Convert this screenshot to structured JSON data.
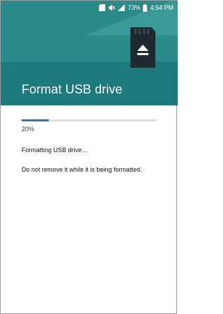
{
  "status_bar": {
    "battery": "73%",
    "time": "4:54 PM",
    "icons": [
      "sd-card-icon",
      "mute-icon",
      "signal-icon",
      "battery-icon"
    ]
  },
  "header": {
    "title": "Format USB drive",
    "icon": "sd-card-eject-icon"
  },
  "progress": {
    "fraction": 0.2,
    "percent_label": "20%"
  },
  "messages": {
    "status": "Formatting USB drive…",
    "warning": "Do not remove it while it is being formatted."
  },
  "colors": {
    "header": "#1d7a7c",
    "progress": "#2f6ed1"
  }
}
